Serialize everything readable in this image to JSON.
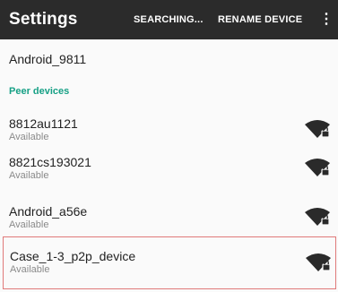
{
  "appbar": {
    "title": "Settings",
    "actions": {
      "searching": "SEARCHING...",
      "rename": "RENAME DEVICE"
    },
    "overflow_icon": "more-vert-icon",
    "background": "#2b2b2b"
  },
  "device": {
    "name": "Android_9811"
  },
  "peer_section": {
    "header": "Peer devices",
    "accent": "#16a085",
    "devices": [
      {
        "name": "8812au1121",
        "status": "Available",
        "icon": "wifi-lock-icon"
      },
      {
        "name": "8821cs193021",
        "status": "Available",
        "icon": "wifi-lock-icon"
      },
      {
        "name": "Android_a56e",
        "status": "Available",
        "icon": "wifi-lock-icon"
      },
      {
        "name": "Case_1-3_p2p_device",
        "status": "Available",
        "icon": "wifi-lock-icon",
        "highlighted": true
      }
    ]
  }
}
